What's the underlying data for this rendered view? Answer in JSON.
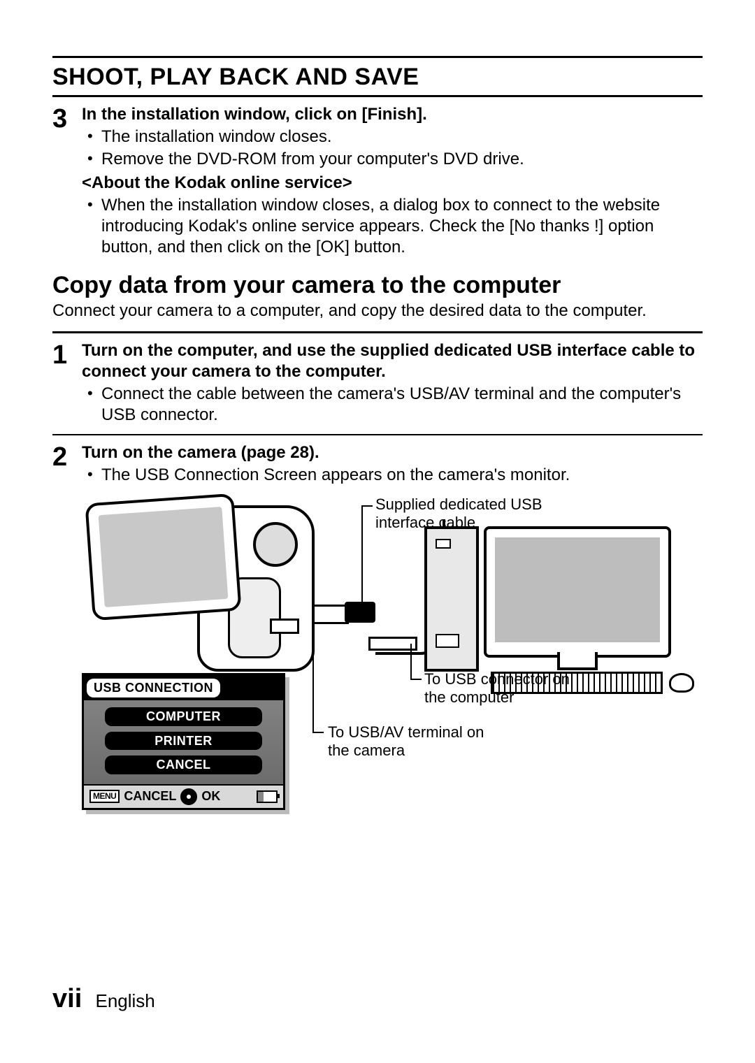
{
  "header": {
    "title": "SHOOT, PLAY BACK AND SAVE"
  },
  "step3": {
    "num": "3",
    "head": "In the installation window, click on [Finish].",
    "bullets": [
      "The installation window closes.",
      "Remove the DVD-ROM from your computer's DVD drive."
    ],
    "sub_head": "<About the Kodak online service>",
    "sub_bullet": "When the installation window closes, a dialog box to connect to the website introducing Kodak's online service appears. Check the [No thanks !] option button, and then click on the [OK] button."
  },
  "section2": {
    "title": "Copy data from your camera to the computer",
    "intro": "Connect your camera to a computer, and copy the desired data to the computer."
  },
  "step1": {
    "num": "1",
    "head": "Turn on the computer, and use the supplied dedicated USB interface cable to connect your camera to the computer.",
    "bullet": "Connect the cable between the camera's USB/AV terminal and the computer's USB connector."
  },
  "step2": {
    "num": "2",
    "head": "Turn on the camera (page 28).",
    "bullet": "The USB Connection Screen appears on the camera's monitor."
  },
  "diagram": {
    "label_cable": "Supplied dedicated USB interface cable",
    "label_usb_pc": "To USB connector on the computer",
    "label_usb_cam": "To USB/AV terminal on the camera"
  },
  "usb_menu": {
    "title": "USB CONNECTION",
    "options": [
      "COMPUTER",
      "PRINTER",
      "CANCEL"
    ],
    "footer_menu": "MENU",
    "footer_cancel": "CANCEL",
    "footer_ok": "OK"
  },
  "footer": {
    "page": "vii",
    "lang": "English"
  }
}
